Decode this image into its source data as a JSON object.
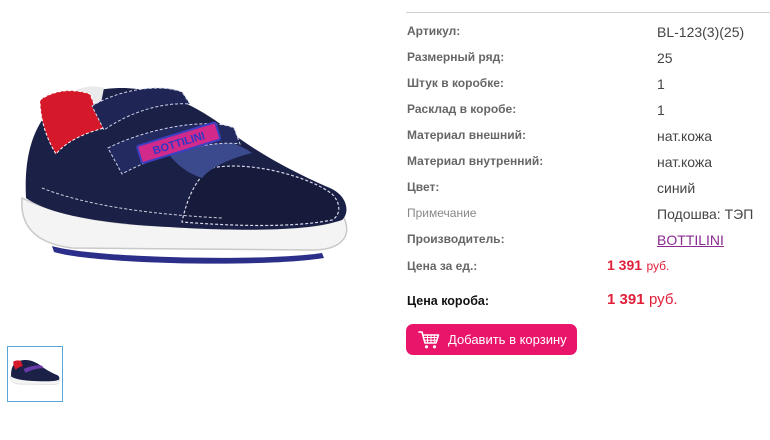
{
  "product": {
    "image_alt": "BOTTILINI",
    "shoe_brand_text": "BOTTILINI",
    "specs": [
      {
        "label": "Артикул:",
        "value": "BL-123(3)(25)"
      },
      {
        "label": "Размерный ряд:",
        "value": "25"
      },
      {
        "label": "Штук в коробке:",
        "value": "1"
      },
      {
        "label": "Расклад в коробе:",
        "value": "1"
      },
      {
        "label": "Материал внешний:",
        "value": "нат.кожа"
      },
      {
        "label": "Материал внутренний:",
        "value": "нат.кожа"
      },
      {
        "label": "Цвет:",
        "value": "синий"
      },
      {
        "label": "Примечание",
        "value": "Подошва: ТЭП"
      },
      {
        "label": "Производитель:",
        "value": "BOTTILINI"
      }
    ],
    "unit_price": {
      "label": "Цена за ед.:",
      "amount": "1 391",
      "currency": "руб."
    },
    "box_price": {
      "label": "Цена короба:",
      "amount": "1 391",
      "currency": "руб."
    },
    "add_to_cart_label": "Добавить в корзину"
  },
  "colors": {
    "price": "#e0203a",
    "cart_button": "#e8156a",
    "manufacturer_link": "#8a2a8f"
  },
  "icons": {
    "cart": "shopping-cart-icon"
  }
}
